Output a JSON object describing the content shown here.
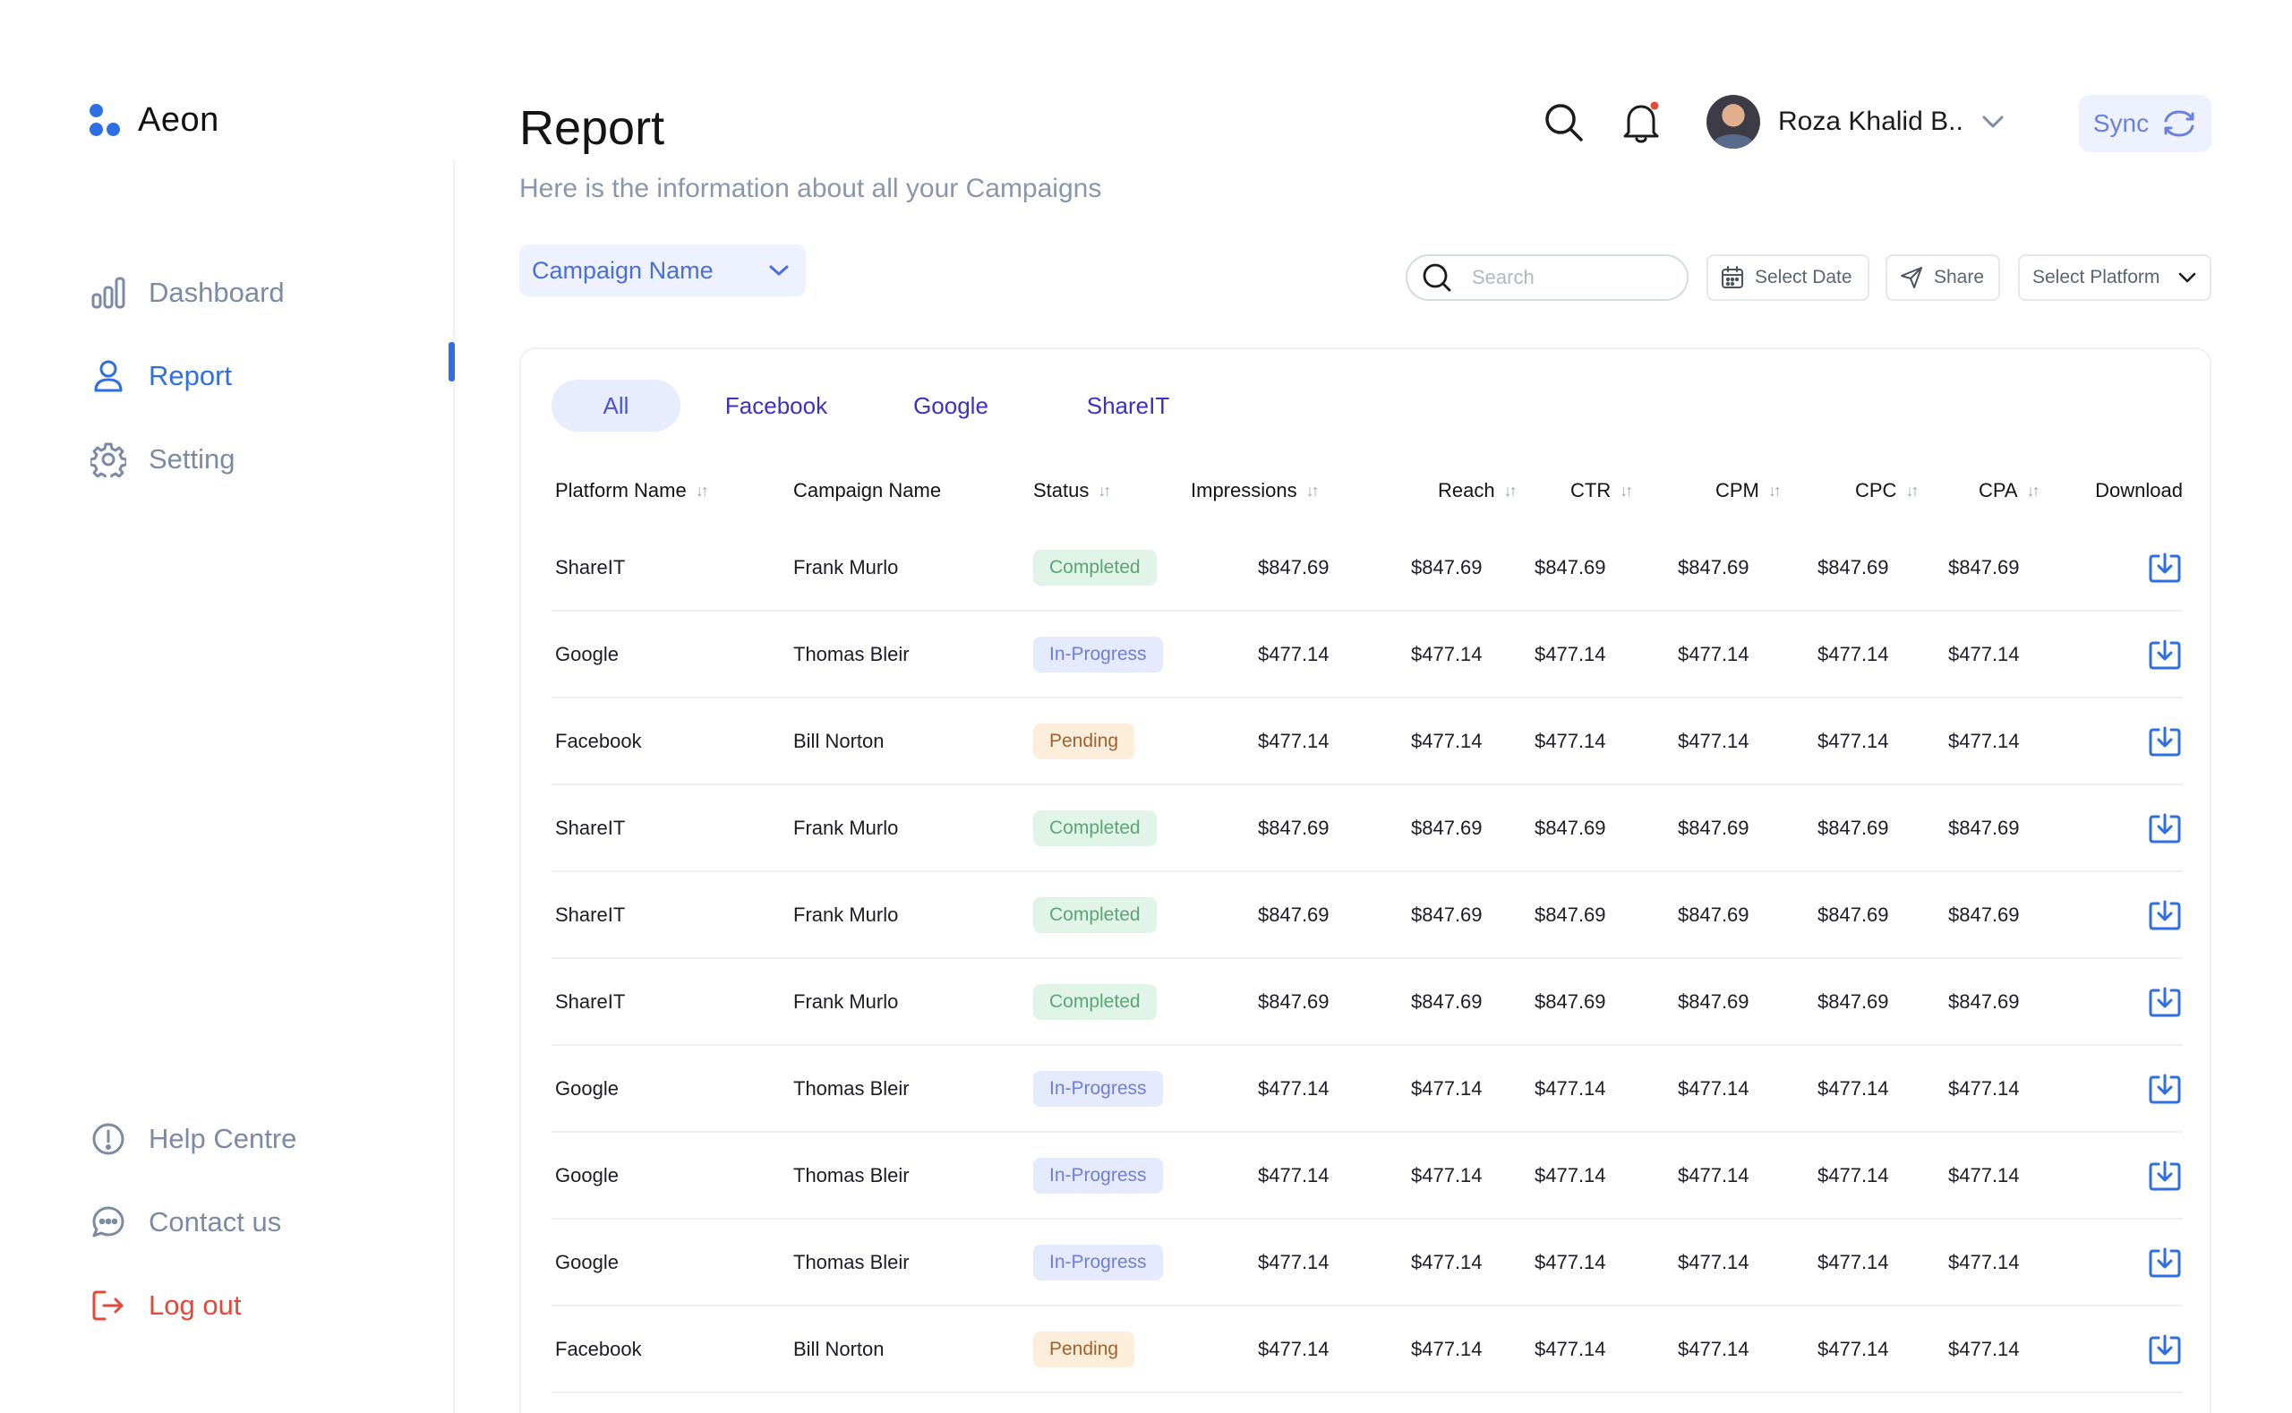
{
  "app": {
    "name": "Aeon"
  },
  "sidebar": {
    "items": [
      {
        "label": "Dashboard",
        "icon": "bar-chart-icon"
      },
      {
        "label": "Report",
        "icon": "user-icon",
        "active": true
      },
      {
        "label": "Setting",
        "icon": "gear-icon"
      }
    ],
    "bottom_items": [
      {
        "label": "Help Centre",
        "icon": "info-circle-icon"
      },
      {
        "label": "Contact us",
        "icon": "chat-bubble-icon"
      },
      {
        "label": "Log out",
        "icon": "logout-icon"
      }
    ]
  },
  "header": {
    "title": "Report",
    "subtitle": "Here is the information about all your Campaigns",
    "user_name": "Roza Khalid B..",
    "sync_label": "Sync"
  },
  "filters": {
    "campaign_select": "Campaign Name",
    "search_placeholder": "Search",
    "date_label": "Select Date",
    "share_label": "Share",
    "platform_label": "Select Platform"
  },
  "tabs": [
    "All",
    "Facebook",
    "Google",
    "ShareIT"
  ],
  "table": {
    "columns": [
      "Platform Name",
      "Campaign Name",
      "Status",
      "Impressions",
      "Reach",
      "CTR",
      "CPM",
      "CPC",
      "CPA",
      "Download"
    ],
    "rows": [
      {
        "platform": "ShareIT",
        "campaign": "Frank Murlo",
        "status": "Completed",
        "impressions": "$847.69",
        "reach": "$847.69",
        "ctr": "$847.69",
        "cpm": "$847.69",
        "cpc": "$847.69",
        "cpa": "$847.69"
      },
      {
        "platform": "Google",
        "campaign": "Thomas  Bleir",
        "status": "In-Progress",
        "impressions": "$477.14",
        "reach": "$477.14",
        "ctr": "$477.14",
        "cpm": "$477.14",
        "cpc": "$477.14",
        "cpa": "$477.14"
      },
      {
        "platform": "Facebook",
        "campaign": "Bill Norton",
        "status": "Pending",
        "impressions": "$477.14",
        "reach": "$477.14",
        "ctr": "$477.14",
        "cpm": "$477.14",
        "cpc": "$477.14",
        "cpa": "$477.14"
      },
      {
        "platform": "ShareIT",
        "campaign": "Frank Murlo",
        "status": "Completed",
        "impressions": "$847.69",
        "reach": "$847.69",
        "ctr": "$847.69",
        "cpm": "$847.69",
        "cpc": "$847.69",
        "cpa": "$847.69"
      },
      {
        "platform": "ShareIT",
        "campaign": "Frank Murlo",
        "status": "Completed",
        "impressions": "$847.69",
        "reach": "$847.69",
        "ctr": "$847.69",
        "cpm": "$847.69",
        "cpc": "$847.69",
        "cpa": "$847.69"
      },
      {
        "platform": "ShareIT",
        "campaign": "Frank Murlo",
        "status": "Completed",
        "impressions": "$847.69",
        "reach": "$847.69",
        "ctr": "$847.69",
        "cpm": "$847.69",
        "cpc": "$847.69",
        "cpa": "$847.69"
      },
      {
        "platform": "Google",
        "campaign": "Thomas  Bleir",
        "status": "In-Progress",
        "impressions": "$477.14",
        "reach": "$477.14",
        "ctr": "$477.14",
        "cpm": "$477.14",
        "cpc": "$477.14",
        "cpa": "$477.14"
      },
      {
        "platform": "Google",
        "campaign": "Thomas  Bleir",
        "status": "In-Progress",
        "impressions": "$477.14",
        "reach": "$477.14",
        "ctr": "$477.14",
        "cpm": "$477.14",
        "cpc": "$477.14",
        "cpa": "$477.14"
      },
      {
        "platform": "Google",
        "campaign": "Thomas  Bleir",
        "status": "In-Progress",
        "impressions": "$477.14",
        "reach": "$477.14",
        "ctr": "$477.14",
        "cpm": "$477.14",
        "cpc": "$477.14",
        "cpa": "$477.14"
      },
      {
        "platform": "Facebook",
        "campaign": "Bill Norton",
        "status": "Pending",
        "impressions": "$477.14",
        "reach": "$477.14",
        "ctr": "$477.14",
        "cpm": "$477.14",
        "cpc": "$477.14",
        "cpa": "$477.14"
      }
    ]
  },
  "colors": {
    "accent": "#2f6fe4",
    "logout": "#e5483a",
    "completed": "#5ca578",
    "in_progress": "#6f7fd6",
    "pending": "#a0622a"
  }
}
